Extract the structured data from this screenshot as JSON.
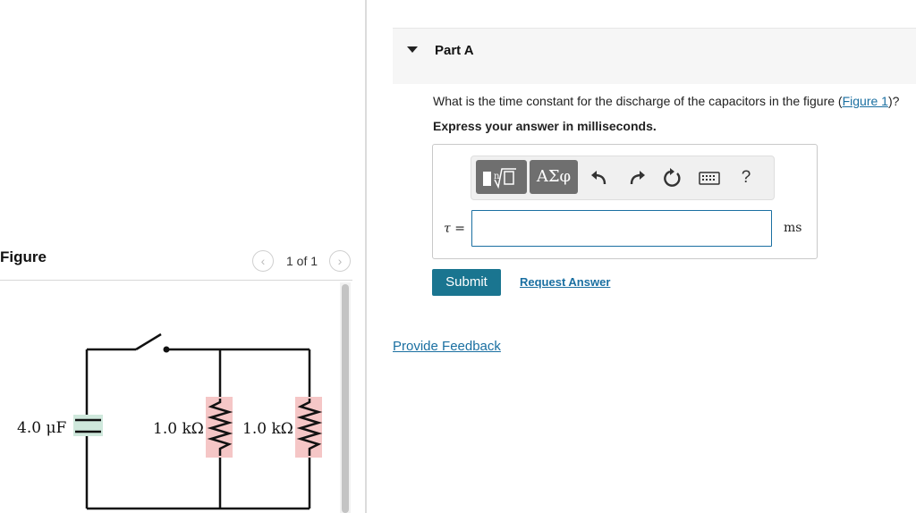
{
  "figure": {
    "title": "Figure",
    "pager": "1 of 1",
    "prev_icon": "chevron-left-icon",
    "next_icon": "chevron-right-icon",
    "circuit": {
      "capacitor_label": "4.0 μF",
      "resistor1_label": "1.0 kΩ",
      "resistor2_label": "1.0 kΩ"
    }
  },
  "part": {
    "title": "Part A",
    "question_before": "What is the time constant for the discharge of the capacitors in the figure (",
    "figure_link": "Figure 1",
    "question_after": ")?",
    "instruction": "Express your answer in milliseconds."
  },
  "toolbar": {
    "greek_label": "ΑΣφ",
    "help_label": "?",
    "icons": [
      "templates-icon",
      "greek-symbols-icon",
      "undo-icon",
      "redo-icon",
      "reset-icon",
      "keyboard-icon",
      "help-icon"
    ]
  },
  "answer": {
    "variable_label": "τ =",
    "value": "",
    "unit": "ms"
  },
  "actions": {
    "submit_label": "Submit",
    "request_label": "Request Answer",
    "feedback_label": "Provide Feedback"
  },
  "colors": {
    "accent": "#1a7590",
    "link": "#1a6fa1",
    "capacitor_fill": "#cfe8dc",
    "resistor_fill": "#f5c6c6"
  }
}
